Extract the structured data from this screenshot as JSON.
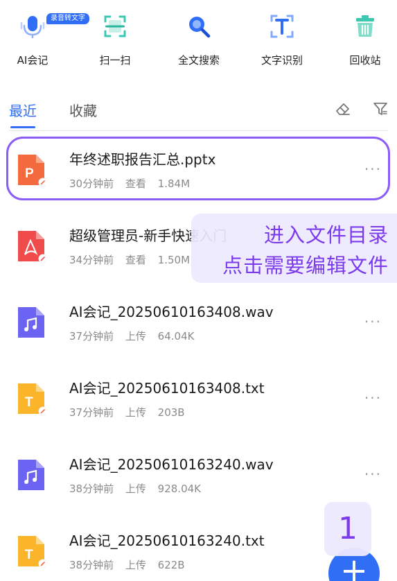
{
  "toolbar": {
    "items": [
      {
        "label": "AI会记",
        "badge": "录音转文字"
      },
      {
        "label": "扫一扫"
      },
      {
        "label": "全文搜索"
      },
      {
        "label": "文字识别"
      },
      {
        "label": "回收站"
      }
    ]
  },
  "tabs": {
    "recent": "最近",
    "favorites": "收藏"
  },
  "files": [
    {
      "name": "年终述职报告汇总.pptx",
      "time": "30分钟前",
      "action": "查看",
      "size": "1.84M",
      "type": "pptx",
      "icon_letter": "P",
      "icon_color": "#f26a3d"
    },
    {
      "name": "超级管理员-新手快速入门",
      "time": "34分钟前",
      "action": "查看",
      "size": "1.50M",
      "type": "pdf",
      "icon_color": "#f04c4c"
    },
    {
      "name": "AI会记_20250610163408.wav",
      "time": "37分钟前",
      "action": "上传",
      "size": "64.04K",
      "type": "wav",
      "icon_color": "#6d63f2"
    },
    {
      "name": "AI会记_20250610163408.txt",
      "time": "37分钟前",
      "action": "上传",
      "size": "203B",
      "type": "txt",
      "icon_letter": "T",
      "icon_color": "#fbb52a"
    },
    {
      "name": "AI会记_20250610163240.wav",
      "time": "38分钟前",
      "action": "上传",
      "size": "928.04K",
      "type": "wav",
      "icon_color": "#6d63f2"
    },
    {
      "name": "AI会记_20250610163240.txt",
      "time": "38分钟前",
      "action": "上传",
      "size": "622B",
      "type": "txt",
      "icon_letter": "T",
      "icon_color": "#fbb52a"
    }
  ],
  "more_label": "···",
  "callout": {
    "line1": "进入文件目录",
    "line2": "点击需要编辑文件"
  },
  "step_number": "1",
  "fab_label": "+",
  "colors": {
    "accent": "#2f6ef5",
    "highlight": "#8b5cf6",
    "callout_text": "#7c3aed"
  }
}
